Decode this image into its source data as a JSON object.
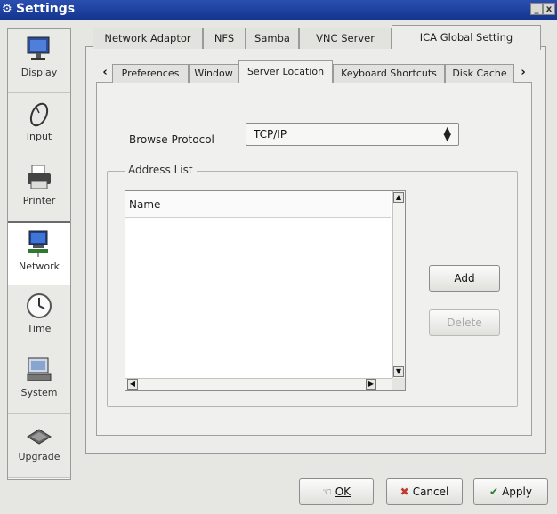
{
  "window": {
    "title": "Settings",
    "minimize": "_",
    "close": "x"
  },
  "categories": [
    {
      "label": "Display",
      "icon": "monitor-icon"
    },
    {
      "label": "Input",
      "icon": "mouse-icon"
    },
    {
      "label": "Printer",
      "icon": "printer-icon"
    },
    {
      "label": "Network",
      "icon": "network-computer-icon"
    },
    {
      "label": "Time",
      "icon": "clock-icon"
    },
    {
      "label": "System",
      "icon": "system-icon"
    },
    {
      "label": "Upgrade",
      "icon": "chip-icon"
    }
  ],
  "selected_category": "Network",
  "main_tabs": [
    "Network Adaptor",
    "NFS",
    "Samba",
    "VNC Server",
    "ICA Global Setting"
  ],
  "active_main_tab": "ICA Global Setting",
  "sub_tabs": [
    "Preferences",
    "Window",
    "Server Location",
    "Keyboard Shortcuts",
    "Disk Cache"
  ],
  "active_sub_tab": "Server Location",
  "form": {
    "browse_protocol_label": "Browse Protocol",
    "browse_protocol_value": "TCP/IP",
    "address_list_title": "Address List",
    "list_column_name": "Name"
  },
  "side_buttons": {
    "add": "Add",
    "delete": "Delete"
  },
  "footer_buttons": {
    "ok": "OK",
    "cancel": "Cancel",
    "apply": "Apply"
  },
  "colors": {
    "titlebar": "#1f44a6",
    "cancel_glyph": "#c0392b",
    "apply_glyph": "#2e7d32"
  }
}
